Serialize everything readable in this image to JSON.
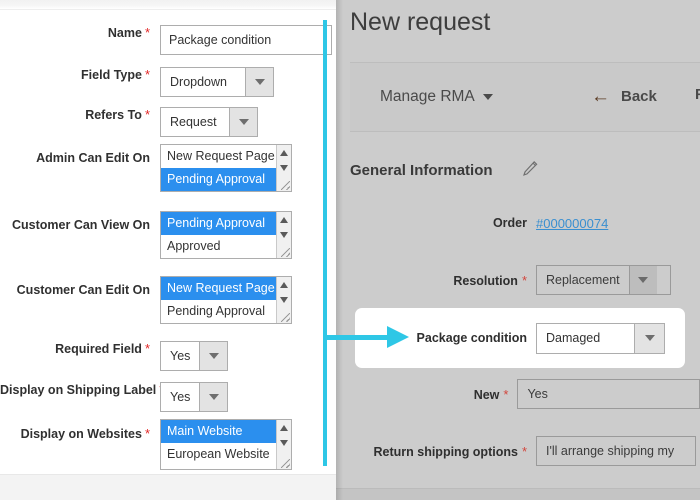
{
  "colors": {
    "accent_cyan": "#2ec7e6",
    "select_highlight": "#2b8fee",
    "required_star": "#e22626",
    "link_blue": "#3a8fd0",
    "overlay_gray": "#cccccc"
  },
  "admin_form": {
    "rows": [
      {
        "label": "Name",
        "required": true,
        "control": "text",
        "value": "Package condition"
      },
      {
        "label": "Field Type",
        "required": true,
        "control": "select",
        "value": "Dropdown"
      },
      {
        "label": "Refers To",
        "required": true,
        "control": "select",
        "value": "Request"
      },
      {
        "label": "Admin Can Edit On",
        "required": false,
        "control": "multiselect",
        "options": [
          {
            "label": "New Request Page",
            "selected": false
          },
          {
            "label": "Pending Approval",
            "selected": true
          }
        ]
      },
      {
        "label": "Customer Can View On",
        "required": false,
        "control": "multiselect",
        "options": [
          {
            "label": "Pending Approval",
            "selected": true
          },
          {
            "label": "Approved",
            "selected": false
          }
        ]
      },
      {
        "label": "Customer Can Edit On",
        "required": false,
        "control": "multiselect",
        "options": [
          {
            "label": "New Request Page",
            "selected": true
          },
          {
            "label": "Pending Approval",
            "selected": false
          }
        ]
      },
      {
        "label": "Required Field",
        "required": true,
        "control": "select",
        "value": "Yes"
      },
      {
        "label": "Display on Shipping Label",
        "required": true,
        "control": "select",
        "value": "Yes"
      },
      {
        "label": "Display on Websites",
        "required": true,
        "control": "multiselect",
        "options": [
          {
            "label": "Main Website",
            "selected": true
          },
          {
            "label": "European Website",
            "selected": false
          }
        ]
      }
    ]
  },
  "storefront": {
    "title": "New request",
    "toolbar": {
      "menu_label": "Manage RMA",
      "back_label": "Back",
      "back_arrow": "←",
      "cutoff_label": "R"
    },
    "section_title": "General Information",
    "rows": [
      {
        "label": "Order",
        "required": false,
        "control": "link",
        "value": "#000000074"
      },
      {
        "label": "Resolution",
        "required": true,
        "control": "select",
        "value": "Replacement"
      },
      {
        "label": "New",
        "required": true,
        "control": "input",
        "value": "Yes"
      },
      {
        "label": "Return shipping options",
        "required": true,
        "control": "input",
        "value": "I'll arrange shipping my"
      }
    ],
    "highlighted_row": {
      "label": "Package condition",
      "required": false,
      "control": "select",
      "value": "Damaged"
    }
  },
  "annotation": {
    "kind": "cyan-pointer-arrow",
    "points_to": "Package condition"
  },
  "icons": {
    "edit_pencil": "pencil-icon",
    "dropdown_caret": "chevron-down-icon",
    "scroll_up": "scroll-up-arrow-icon",
    "scroll_down": "scroll-down-arrow-icon",
    "resize_grip": "resize-grip-icon"
  }
}
